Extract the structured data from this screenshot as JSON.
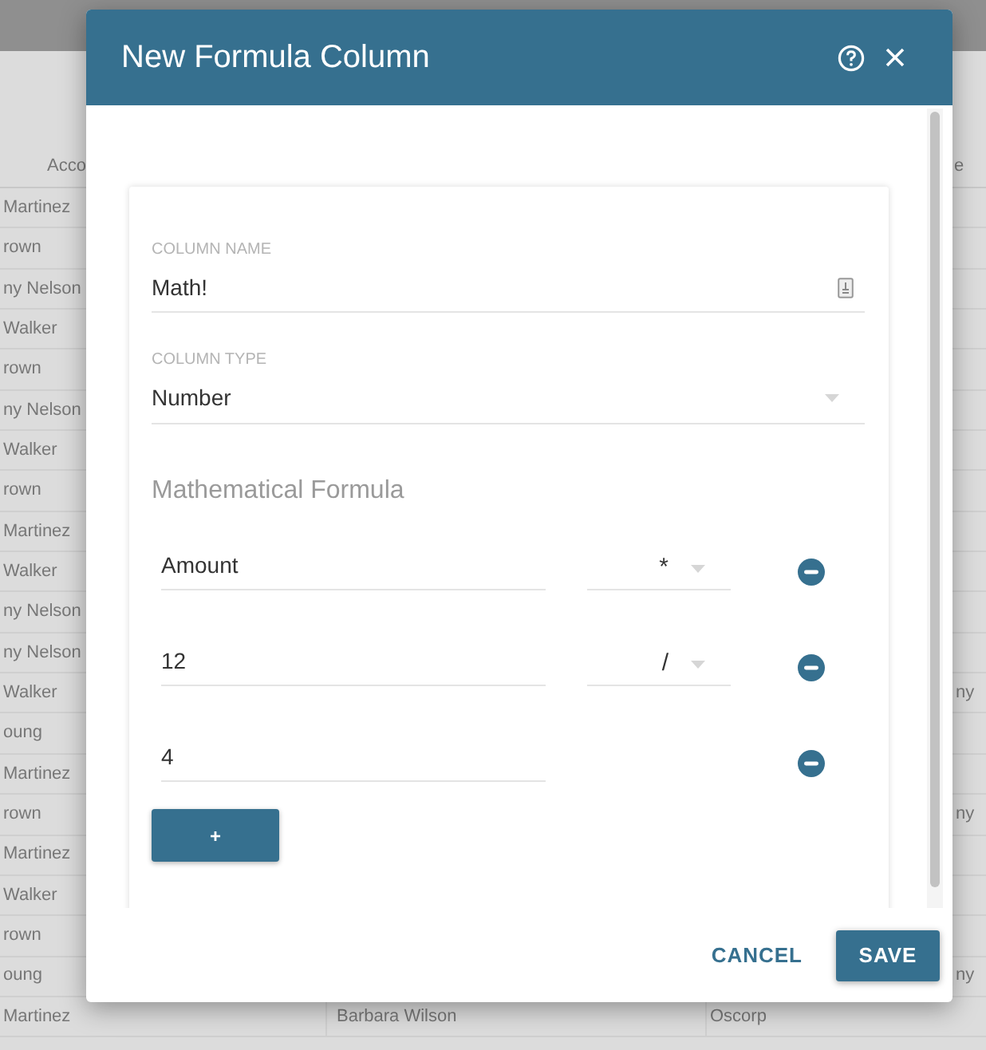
{
  "background_table": {
    "header": {
      "column_1": "Acco",
      "column_4": "e"
    },
    "rows": [
      {
        "column_1": "Martinez"
      },
      {
        "column_1": "rown"
      },
      {
        "column_1": "ny Nelson"
      },
      {
        "column_1": "Walker"
      },
      {
        "column_1": "rown"
      },
      {
        "column_1": "ny Nelson"
      },
      {
        "column_1": "Walker"
      },
      {
        "column_1": "rown"
      },
      {
        "column_1": "Martinez"
      },
      {
        "column_1": "Walker"
      },
      {
        "column_1": "ny Nelson"
      },
      {
        "column_1": "ny Nelson"
      },
      {
        "column_1": "Walker",
        "column_4": "ny"
      },
      {
        "column_1": "oung"
      },
      {
        "column_1": "Martinez"
      },
      {
        "column_1": "rown",
        "column_4": "ny"
      },
      {
        "column_1": "Martinez"
      },
      {
        "column_1": "Walker"
      },
      {
        "column_1": "rown"
      },
      {
        "column_1": "oung",
        "column_4": "ny"
      },
      {
        "column_1": "Martinez",
        "column_2": "Barbara Wilson",
        "column_3": "Oscorp"
      }
    ]
  },
  "dialog": {
    "title": "New Formula Column",
    "column_name": {
      "label": "COLUMN NAME",
      "value": "Math!"
    },
    "column_type": {
      "label": "COLUMN TYPE",
      "value": "Number"
    },
    "formula_heading": "Mathematical Formula",
    "formula_rows": [
      {
        "operand": "Amount",
        "operator": "*"
      },
      {
        "operand": "12",
        "operator": "/"
      },
      {
        "operand": "4"
      }
    ],
    "add_button": "+",
    "buttons": [
      {
        "kind": "text",
        "label": "CANCEL"
      },
      {
        "kind": "filled",
        "label": "SAVE"
      }
    ]
  }
}
